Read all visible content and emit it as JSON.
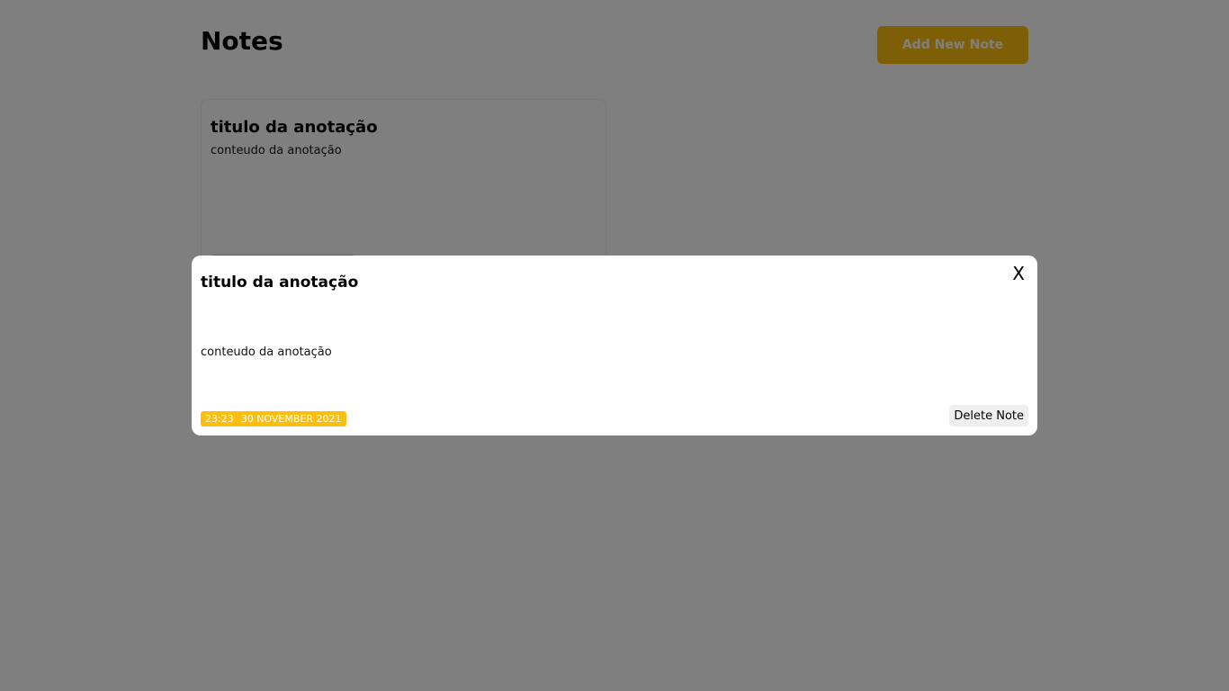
{
  "header": {
    "title": "Notes",
    "add_button_label": "Add New Note"
  },
  "notes": [
    {
      "title": "titulo da anotação",
      "content": "conteudo da anotação"
    }
  ],
  "modal": {
    "title": "titulo da anotação",
    "close_label": "X",
    "content": "conteudo da anotação",
    "time": "23:23",
    "date": "30 NOVEMBER 2021",
    "delete_label": "Delete Note"
  },
  "colors": {
    "accent": "#ffbe0b",
    "overlay": "rgba(0,0,0,0.5)"
  }
}
